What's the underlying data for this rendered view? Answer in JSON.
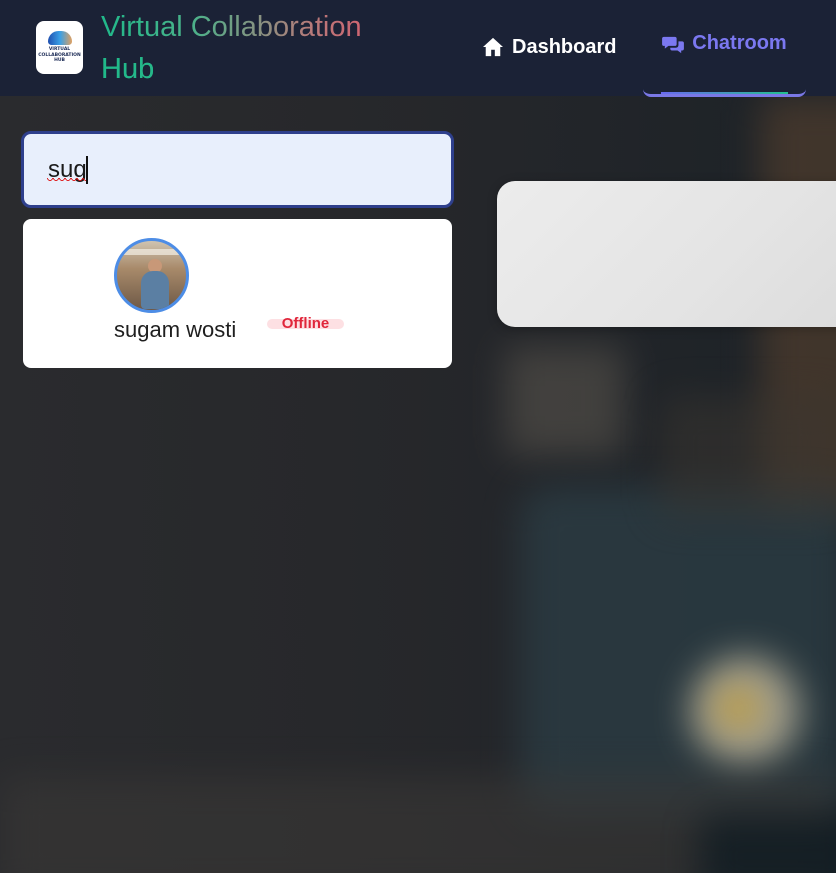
{
  "header": {
    "logo_text": "VIRTUAL COLLABORATION HUB",
    "brand_line1": "Virtual Collaboration",
    "brand_line2": "Hub",
    "nav": {
      "dashboard_label": "Dashboard",
      "dashboard_icon": "home-icon",
      "chatroom_label": "Chatroom",
      "chatroom_icon": "chat-bubbles-icon"
    }
  },
  "search": {
    "value": "sug"
  },
  "results": [
    {
      "name": "sugam wosti",
      "status": "Offline"
    }
  ],
  "colors": {
    "header_bg": "#1b2236",
    "accent": "#7b78f0",
    "offline": "#e0263b",
    "search_border": "#2e3f8c"
  }
}
